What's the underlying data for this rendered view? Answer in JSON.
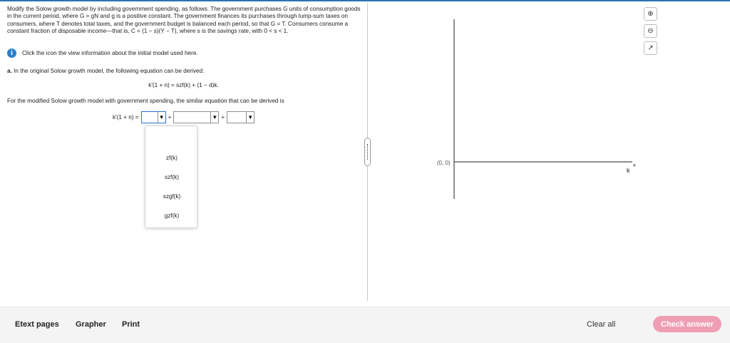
{
  "problem": {
    "statement": "Modify the Solow growth model by including government spending, as follows. The government purchases G units of consumption goods in the current period, where G = gN and g is a positive constant. The government finances its purchases through lump-sum taxes on consumers, where T denotes total taxes, and the government budget is balanced each period, so that G = T. Consumers consume a constant fraction of disposable income—that is, C = (1 − s)(Y − T), where s is the savings rate, with 0 < s < 1.",
    "info_text": "Click the icon the view information about the initial model used here.",
    "info_icon": "info-icon",
    "part_label": "a.",
    "part_text": "In the original Solow growth model, the following equation can be derived:",
    "original_equation": "k′(1 + n) = szf(k) + (1 − d)k.",
    "modified_text": "For the modified Solow growth model with government spending, the similar equation that can be derived is",
    "modified_lhs": "k′(1 + n) =",
    "plus": "+",
    "dropdown_arrow": "▼"
  },
  "dropdown_menu": {
    "options": [
      "zf(k)",
      "szf(k)",
      "szgf(k)",
      "gzf(k)"
    ]
  },
  "graph": {
    "origin_label": "(0, 0)",
    "x_axis_label": "k",
    "tools": {
      "zoom_in": "⊕",
      "zoom_out": "⊖",
      "popout": "↗"
    }
  },
  "footer": {
    "etext": "Etext pages",
    "grapher": "Grapher",
    "print": "Print",
    "clear_all": "Clear all",
    "check_answer": "Check answer"
  },
  "colors": {
    "accent": "#2c74b3",
    "check_button": "#ee9fb5",
    "focus_border": "#2b6fd1"
  }
}
